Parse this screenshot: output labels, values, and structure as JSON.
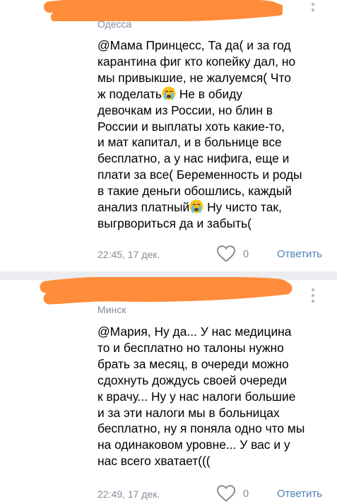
{
  "comments": [
    {
      "city": "Одесса",
      "text_parts": [
        "@Мама Принцесс, Та да( и за год\nкарантина фиг кто копейку дал, но\nмы привыкшие, не жалуемся( Что\nж поделать",
        " Не в обиду\nдевочкам из России, но блин в\nРоссии и выплаты хоть какие-то,\nи мат капитал, и в больнице все\nбесплатно, а у нас нифига, еще и\nплати за все( Беременность и роды\nв такие деньги обошлись, каждый\nанализ платный",
        " Ну чисто так,\nвыгрвориться да и забыть("
      ],
      "time": "22:45, 17 дек.",
      "likes": "0",
      "reply": "Ответить"
    },
    {
      "city": "Минск",
      "text": "@Мария, Ну да... У нас медицина\nто и бесплатно но талоны нужно\nбрать за месяц, в очереди можно\nсдохнуть дождусь своей очереди\nк врачу... Ну у нас налоги большие\nи за эти налоги мы в больницах\nбесплатно, ну я поняла одно что мы\nна одинаковом уровне... У вас и у\nнас всего хватает(((",
      "time": "22:49, 17 дек.",
      "likes": "0",
      "reply": "Ответить"
    }
  ],
  "colors": {
    "scribble": "#ff8c3a",
    "meta_gray": "#818c99",
    "reply_blue": "#5181b8",
    "divider": "#ebedf0"
  },
  "icons": [
    "crying-face-emoji-icon",
    "heart-outline-icon",
    "more-dots-icon"
  ]
}
